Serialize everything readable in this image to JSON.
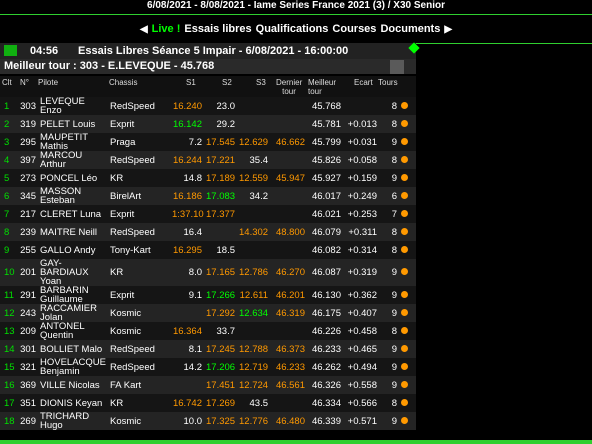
{
  "topbar": {
    "text": "6/08/2021 - 8/08/2021 - Iame Series France 2021 (3) / X30 Senior"
  },
  "nav": {
    "live": "Live !",
    "items": [
      "Essais libres",
      "Qualifications",
      "Courses",
      "Documents"
    ]
  },
  "session": {
    "time": "04:56",
    "title": "Essais Libres Séance 5 Impair - 6/08/2021 - 16:00:00"
  },
  "best_lap": "Meilleur tour : 303 - E.LEVEQUE - 45.768",
  "columns": {
    "clt": "Clt",
    "num": "N°",
    "pilote": "Pilote",
    "chassis": "Chassis",
    "s1": "S1",
    "s2": "S2",
    "s3": "S3",
    "dernier": "Dernier tour",
    "meilleur": "Meilleur tour",
    "ecart": "Ecart",
    "tours": "Tours"
  },
  "rows": [
    {
      "clt": "1",
      "num": "303",
      "pilot": "LEVEQUE Enzo",
      "chassis": "RedSpeed",
      "s1": "16.240",
      "s1c": "orange",
      "s2": "23.0",
      "s2c": "",
      "s3": "",
      "s3c": "",
      "last": "",
      "lastc": "",
      "best": "45.768",
      "gap": "",
      "laps": "8"
    },
    {
      "clt": "2",
      "num": "319",
      "pilot": "PELET Louis",
      "chassis": "Exprit",
      "s1": "16.142",
      "s1c": "green",
      "s2": "29.2",
      "s2c": "",
      "s3": "",
      "s3c": "",
      "last": "",
      "lastc": "",
      "best": "45.781",
      "gap": "+0.013",
      "laps": "8"
    },
    {
      "clt": "3",
      "num": "295",
      "pilot": "MAUPETIT Mathis",
      "chassis": "Praga",
      "s1": "7.2",
      "s1c": "",
      "s2": "17.545",
      "s2c": "orange",
      "s3": "12.629",
      "s3c": "orange",
      "last": "46.662",
      "lastc": "orange",
      "best": "45.799",
      "gap": "+0.031",
      "laps": "9"
    },
    {
      "clt": "4",
      "num": "397",
      "pilot": "MARCOU Arthur",
      "chassis": "RedSpeed",
      "s1": "16.244",
      "s1c": "orange",
      "s2": "17.221",
      "s2c": "orange",
      "s3": "35.4",
      "s3c": "",
      "last": "",
      "lastc": "",
      "best": "45.826",
      "gap": "+0.058",
      "laps": "8"
    },
    {
      "clt": "5",
      "num": "273",
      "pilot": "PONCEL Léo",
      "chassis": "KR",
      "s1": "14.8",
      "s1c": "",
      "s2": "17.189",
      "s2c": "orange",
      "s3": "12.559",
      "s3c": "orange",
      "last": "45.947",
      "lastc": "orange",
      "best": "45.927",
      "gap": "+0.159",
      "laps": "9"
    },
    {
      "clt": "6",
      "num": "345",
      "pilot": "MASSON Esteban",
      "chassis": "BirelArt",
      "s1": "16.186",
      "s1c": "orange",
      "s2": "17.083",
      "s2c": "green",
      "s3": "34.2",
      "s3c": "",
      "last": "",
      "lastc": "",
      "best": "46.017",
      "gap": "+0.249",
      "laps": "6"
    },
    {
      "clt": "7",
      "num": "217",
      "pilot": "CLERET Luna",
      "chassis": "Exprit",
      "s1": "1:37.103",
      "s1c": "orange",
      "s2": "17.377",
      "s2c": "orange",
      "s3": "",
      "s3c": "",
      "last": "",
      "lastc": "",
      "best": "46.021",
      "gap": "+0.253",
      "laps": "7"
    },
    {
      "clt": "8",
      "num": "239",
      "pilot": "MAITRE Neill",
      "chassis": "RedSpeed",
      "s1": "16.4",
      "s1c": "",
      "s2": "",
      "s2c": "",
      "s3": "14.302",
      "s3c": "orange",
      "last": "48.800",
      "lastc": "orange",
      "best": "46.079",
      "gap": "+0.311",
      "laps": "8"
    },
    {
      "clt": "9",
      "num": "255",
      "pilot": "GALLO Andy",
      "chassis": "Tony-Kart",
      "s1": "16.295",
      "s1c": "orange",
      "s2": "18.5",
      "s2c": "",
      "s3": "",
      "s3c": "",
      "last": "",
      "lastc": "",
      "best": "46.082",
      "gap": "+0.314",
      "laps": "8"
    },
    {
      "clt": "10",
      "num": "201",
      "pilot": "GAY-BARDIAUX Yoan",
      "chassis": "KR",
      "s1": "8.0",
      "s1c": "",
      "s2": "17.165",
      "s2c": "orange",
      "s3": "12.786",
      "s3c": "orange",
      "last": "46.270",
      "lastc": "orange",
      "best": "46.087",
      "gap": "+0.319",
      "laps": "9"
    },
    {
      "clt": "11",
      "num": "291",
      "pilot": "BARBARIN Guillaume",
      "chassis": "Exprit",
      "s1": "9.1",
      "s1c": "",
      "s2": "17.266",
      "s2c": "green",
      "s3": "12.611",
      "s3c": "orange",
      "last": "46.201",
      "lastc": "orange",
      "best": "46.130",
      "gap": "+0.362",
      "laps": "9"
    },
    {
      "clt": "12",
      "num": "243",
      "pilot": "RACCAMIER Jolan",
      "chassis": "Kosmic",
      "s1": "",
      "s1c": "",
      "s2": "17.292",
      "s2c": "orange",
      "s3": "12.634",
      "s3c": "green",
      "last": "46.319",
      "lastc": "orange",
      "best": "46.175",
      "gap": "+0.407",
      "laps": "9"
    },
    {
      "clt": "13",
      "num": "209",
      "pilot": "ANTONEL Quentin",
      "chassis": "Kosmic",
      "s1": "16.364",
      "s1c": "orange",
      "s2": "33.7",
      "s2c": "",
      "s3": "",
      "s3c": "",
      "last": "",
      "lastc": "",
      "best": "46.226",
      "gap": "+0.458",
      "laps": "8"
    },
    {
      "clt": "14",
      "num": "301",
      "pilot": "BOLLIET Malo",
      "chassis": "RedSpeed",
      "s1": "8.1",
      "s1c": "",
      "s2": "17.245",
      "s2c": "orange",
      "s3": "12.788",
      "s3c": "orange",
      "last": "46.373",
      "lastc": "orange",
      "best": "46.233",
      "gap": "+0.465",
      "laps": "9"
    },
    {
      "clt": "15",
      "num": "321",
      "pilot": "HOVELACQUE Benjamin",
      "chassis": "RedSpeed",
      "s1": "14.2",
      "s1c": "",
      "s2": "17.206",
      "s2c": "green",
      "s3": "12.719",
      "s3c": "orange",
      "last": "46.233",
      "lastc": "orange",
      "best": "46.262",
      "gap": "+0.494",
      "laps": "9"
    },
    {
      "clt": "16",
      "num": "369",
      "pilot": "VILLE Nicolas",
      "chassis": "FA Kart",
      "s1": "",
      "s1c": "",
      "s2": "17.451",
      "s2c": "orange",
      "s3": "12.724",
      "s3c": "orange",
      "last": "46.561",
      "lastc": "orange",
      "best": "46.326",
      "gap": "+0.558",
      "laps": "9"
    },
    {
      "clt": "17",
      "num": "351",
      "pilot": "DIONIS Keyan",
      "chassis": "KR",
      "s1": "16.742",
      "s1c": "orange",
      "s2": "17.269",
      "s2c": "orange",
      "s3": "43.5",
      "s3c": "",
      "last": "",
      "lastc": "",
      "best": "46.334",
      "gap": "+0.566",
      "laps": "8"
    },
    {
      "clt": "18",
      "num": "269",
      "pilot": "TRICHARD Hugo",
      "chassis": "Kosmic",
      "s1": "10.0",
      "s1c": "",
      "s2": "17.325",
      "s2c": "orange",
      "s3": "12.776",
      "s3c": "orange",
      "last": "46.480",
      "lastc": "orange",
      "best": "46.339",
      "gap": "+0.571",
      "laps": "9"
    }
  ]
}
